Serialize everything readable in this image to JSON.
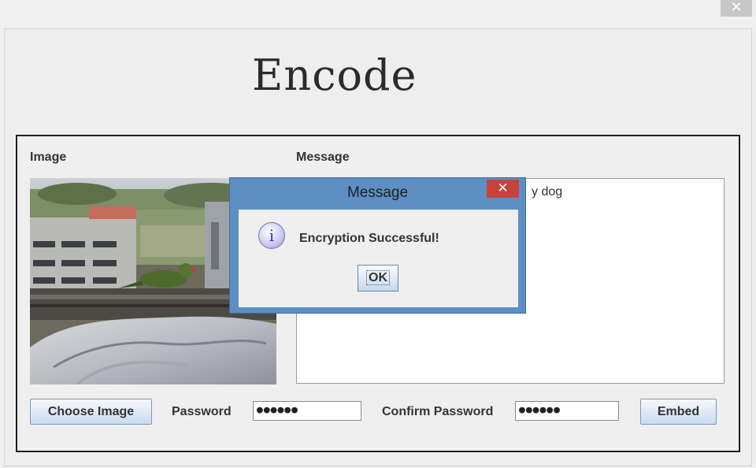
{
  "window": {
    "close_glyph": "✕"
  },
  "header": {
    "title": "Encode"
  },
  "labels": {
    "image": "Image",
    "message": "Message"
  },
  "message_area": {
    "value": "y dog"
  },
  "controls": {
    "choose_image": "Choose Image",
    "password_label": "Password",
    "password_value": "●●●●●●",
    "confirm_label": "Confirm Password",
    "confirm_value": "●●●●●●",
    "embed": "Embed"
  },
  "dialog": {
    "title": "Message",
    "close_glyph": "✕",
    "icon": "info-icon",
    "text": "Encryption Successful!",
    "ok": "OK"
  },
  "colors": {
    "dialog_frame": "#5d8fc3",
    "close_red": "#c9413b",
    "button_blue": "#dde8f5"
  }
}
